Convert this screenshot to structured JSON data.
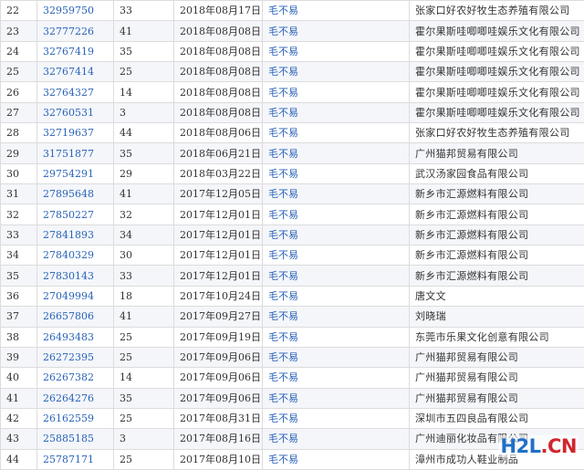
{
  "colors": {
    "link": "#2a63b8",
    "text": "#333333",
    "stripe": "#f4f6fa",
    "border": "#dcdcdc"
  },
  "rows": [
    {
      "idx": "22",
      "reg": "32959750",
      "cls": "33",
      "date": "2018年08月17日",
      "name": "毛不易",
      "owner": "张家口好农好牧生态养殖有限公司"
    },
    {
      "idx": "23",
      "reg": "32777226",
      "cls": "41",
      "date": "2018年08月08日",
      "name": "毛不易",
      "owner": "霍尔果斯哇唧唧哇娱乐文化有限公司"
    },
    {
      "idx": "24",
      "reg": "32767419",
      "cls": "35",
      "date": "2018年08月08日",
      "name": "毛不易",
      "owner": "霍尔果斯哇唧唧哇娱乐文化有限公司"
    },
    {
      "idx": "25",
      "reg": "32767414",
      "cls": "25",
      "date": "2018年08月08日",
      "name": "毛不易",
      "owner": "霍尔果斯哇唧唧哇娱乐文化有限公司"
    },
    {
      "idx": "26",
      "reg": "32764327",
      "cls": "14",
      "date": "2018年08月08日",
      "name": "毛不易",
      "owner": "霍尔果斯哇唧唧哇娱乐文化有限公司"
    },
    {
      "idx": "27",
      "reg": "32760531",
      "cls": "3",
      "date": "2018年08月08日",
      "name": "毛不易",
      "owner": "霍尔果斯哇唧唧哇娱乐文化有限公司"
    },
    {
      "idx": "28",
      "reg": "32719637",
      "cls": "44",
      "date": "2018年08月06日",
      "name": "毛不易",
      "owner": "张家口好农好牧生态养殖有限公司"
    },
    {
      "idx": "29",
      "reg": "31751877",
      "cls": "35",
      "date": "2018年06月21日",
      "name": "毛不易",
      "owner": "广州猫邦贸易有限公司"
    },
    {
      "idx": "30",
      "reg": "29754291",
      "cls": "29",
      "date": "2018年03月22日",
      "name": "毛不易",
      "owner": "武汉汤家园食品有限公司"
    },
    {
      "idx": "31",
      "reg": "27895648",
      "cls": "41",
      "date": "2017年12月05日",
      "name": "毛不易",
      "owner": "新乡市汇源燃料有限公司"
    },
    {
      "idx": "32",
      "reg": "27850227",
      "cls": "32",
      "date": "2017年12月01日",
      "name": "毛不易",
      "owner": "新乡市汇源燃料有限公司"
    },
    {
      "idx": "33",
      "reg": "27841893",
      "cls": "34",
      "date": "2017年12月01日",
      "name": "毛不易",
      "owner": "新乡市汇源燃料有限公司"
    },
    {
      "idx": "34",
      "reg": "27840329",
      "cls": "30",
      "date": "2017年12月01日",
      "name": "毛不易",
      "owner": "新乡市汇源燃料有限公司"
    },
    {
      "idx": "35",
      "reg": "27830143",
      "cls": "33",
      "date": "2017年12月01日",
      "name": "毛不易",
      "owner": "新乡市汇源燃料有限公司"
    },
    {
      "idx": "36",
      "reg": "27049994",
      "cls": "18",
      "date": "2017年10月24日",
      "name": "毛不易",
      "owner": "唐文文"
    },
    {
      "idx": "37",
      "reg": "26657806",
      "cls": "41",
      "date": "2017年09月27日",
      "name": "毛不易",
      "owner": "刘晓瑞"
    },
    {
      "idx": "38",
      "reg": "26493483",
      "cls": "25",
      "date": "2017年09月19日",
      "name": "毛不易",
      "owner": "东莞市乐果文化创意有限公司"
    },
    {
      "idx": "39",
      "reg": "26272395",
      "cls": "25",
      "date": "2017年09月06日",
      "name": "毛不易",
      "owner": "广州猫邦贸易有限公司"
    },
    {
      "idx": "40",
      "reg": "26267382",
      "cls": "14",
      "date": "2017年09月06日",
      "name": "毛不易",
      "owner": "广州猫邦贸易有限公司"
    },
    {
      "idx": "41",
      "reg": "26264276",
      "cls": "35",
      "date": "2017年09月06日",
      "name": "毛不易",
      "owner": "广州猫邦贸易有限公司"
    },
    {
      "idx": "42",
      "reg": "26162559",
      "cls": "25",
      "date": "2017年08月31日",
      "name": "毛不易",
      "owner": "深圳市五四良品有限公司"
    },
    {
      "idx": "43",
      "reg": "25885185",
      "cls": "3",
      "date": "2017年08月16日",
      "name": "毛不易",
      "owner": "广州迪丽化妆品有限公司"
    },
    {
      "idx": "44",
      "reg": "25787171",
      "cls": "25",
      "date": "2017年08月10日",
      "name": "毛不易",
      "owner": "漳州市成功人鞋业制品"
    }
  ],
  "watermark": {
    "part1": "H2L",
    "part2": ".CN"
  }
}
